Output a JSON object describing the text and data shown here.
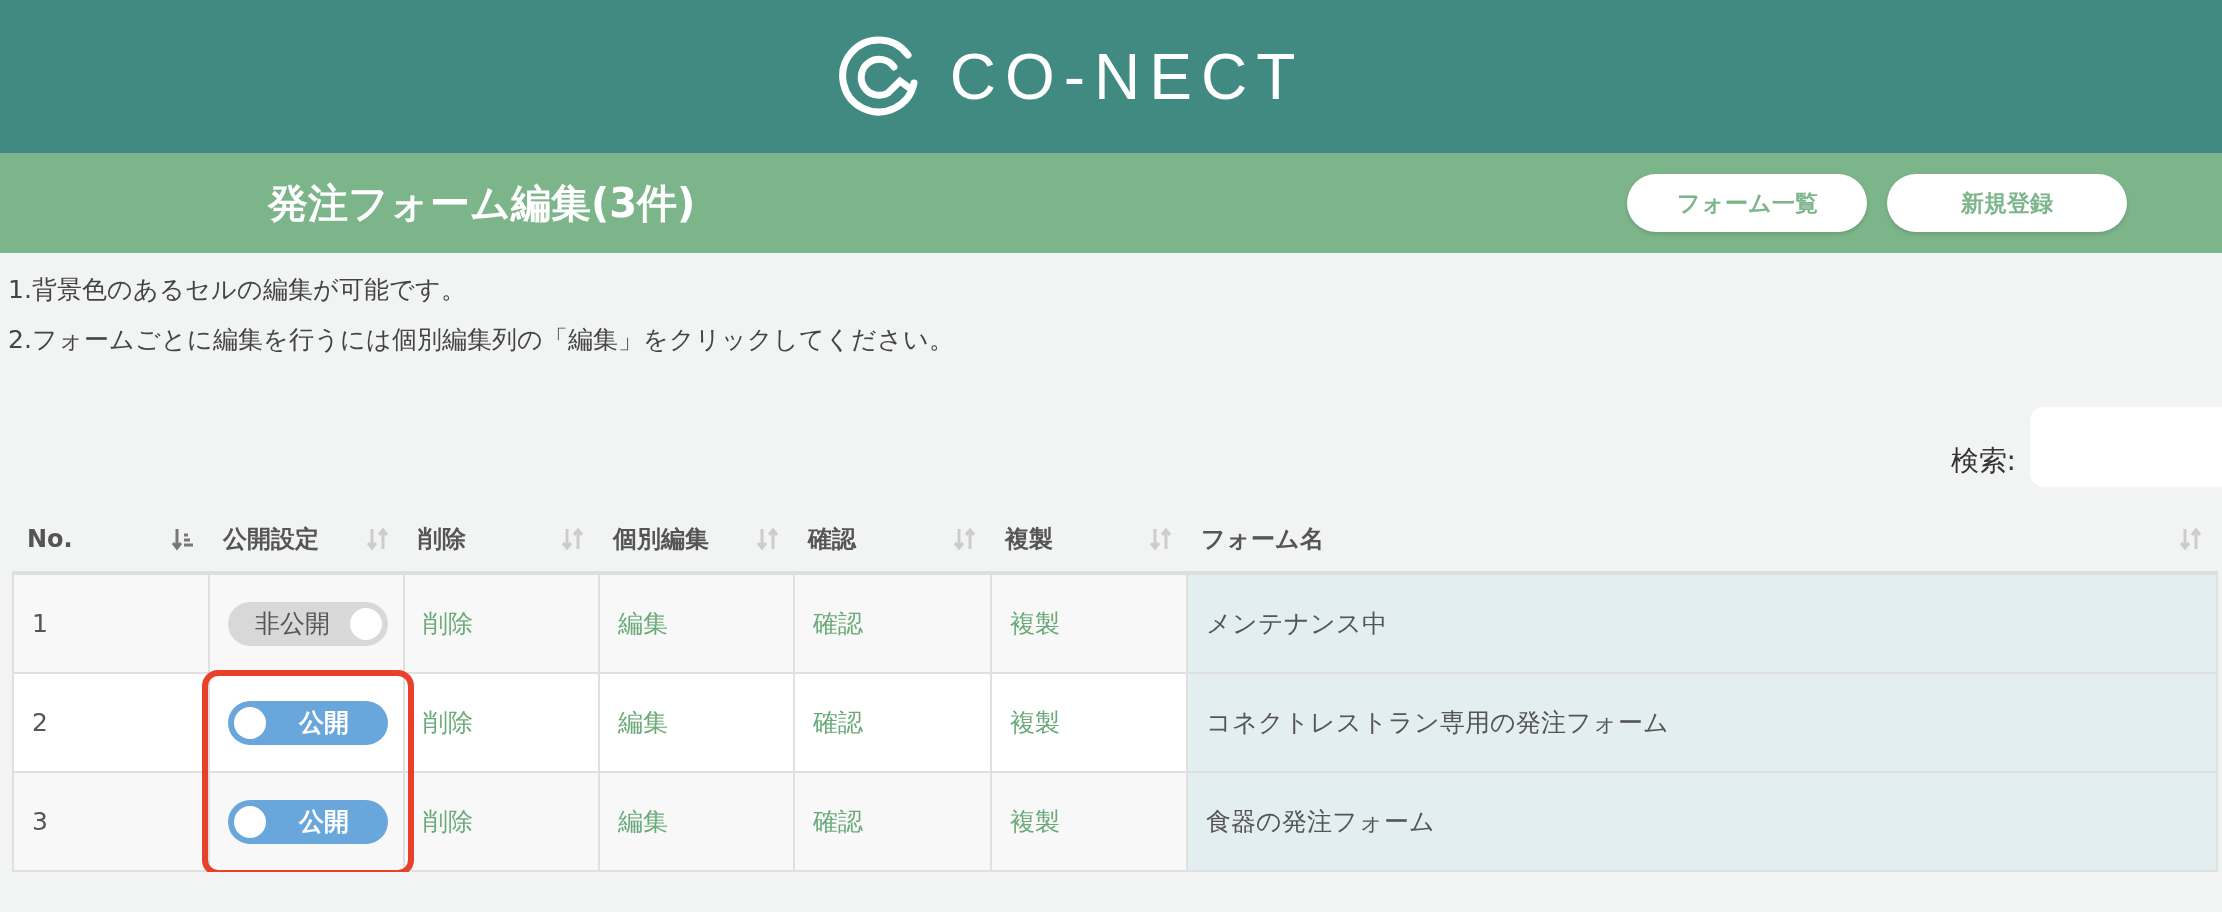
{
  "header": {
    "logo_text": "CO-NECT"
  },
  "title_bar": {
    "title": "発注フォーム編集(3件)",
    "buttons": [
      "フォーム一覧",
      "新規登録"
    ]
  },
  "notes": [
    "1.背景色のあるセルの編集が可能です。",
    "2.フォームごとに編集を行うには個別編集列の「編集」をクリックしてください。"
  ],
  "search": {
    "label": "検索:"
  },
  "table": {
    "columns": [
      {
        "label": "No.",
        "sorted": true
      },
      {
        "label": "公開設定",
        "sorted": false
      },
      {
        "label": "削除",
        "sorted": false
      },
      {
        "label": "個別編集",
        "sorted": false
      },
      {
        "label": "確認",
        "sorted": false
      },
      {
        "label": "複製",
        "sorted": false
      },
      {
        "label": "フォーム名",
        "sorted": false
      }
    ],
    "rows": [
      {
        "no": "1",
        "toggle": {
          "label": "非公開",
          "on": false
        },
        "delete": "削除",
        "edit": "編集",
        "confirm": "確認",
        "copy": "複製",
        "form_name": "メンテナンス中",
        "highlighted": false
      },
      {
        "no": "2",
        "toggle": {
          "label": "公開",
          "on": true
        },
        "delete": "削除",
        "edit": "編集",
        "confirm": "確認",
        "copy": "複製",
        "form_name": "コネクトレストラン専用の発注フォーム",
        "highlighted": true
      },
      {
        "no": "3",
        "toggle": {
          "label": "公開",
          "on": true
        },
        "delete": "削除",
        "edit": "編集",
        "confirm": "確認",
        "copy": "複製",
        "form_name": "食器の発注フォーム",
        "highlighted": true
      }
    ]
  }
}
